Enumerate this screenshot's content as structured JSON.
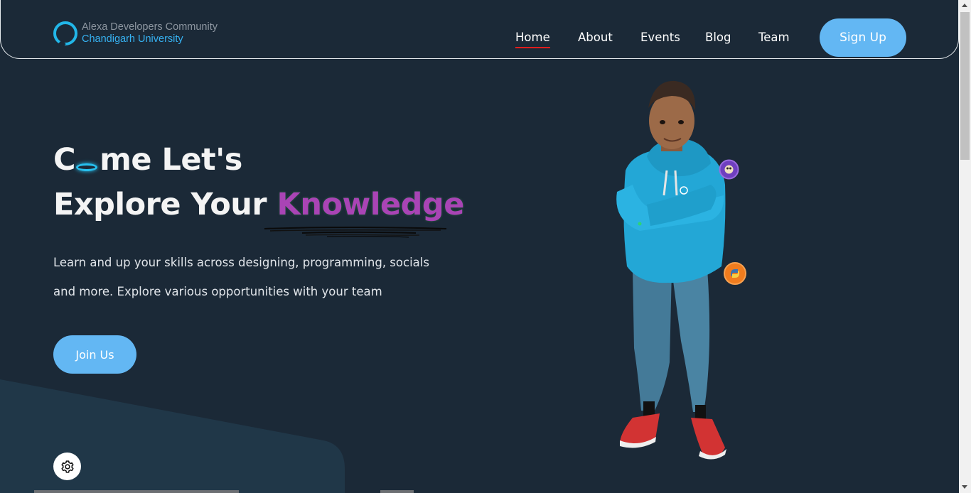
{
  "brand": {
    "line1": "Alexa Developers Community",
    "line2": "Chandigarh University",
    "icon": "alexa-ring-icon"
  },
  "nav": {
    "items": [
      {
        "label": "Home",
        "active": true
      },
      {
        "label": "About",
        "active": false
      },
      {
        "label": "Events",
        "active": false
      },
      {
        "label": "Blog",
        "active": false
      },
      {
        "label": "Team",
        "active": false
      }
    ],
    "signup_label": "Sign Up"
  },
  "hero": {
    "line1_start": "C",
    "line1_end": "me Let's",
    "line2_start": "Explore Your ",
    "line2_highlight": "Knowledge",
    "desc_line1": "Learn and up your skills across designing, programming, socials",
    "desc_line2": "and more. Explore various opportunities with your team",
    "join_label": "Join Us"
  },
  "settings": {
    "icon": "gear-icon"
  },
  "colors": {
    "background": "#1b2937",
    "accent": "#63b7f3",
    "highlight": "#a944b5",
    "active_underline": "#e11d1d",
    "alexa_blue": "#22b6e8"
  }
}
